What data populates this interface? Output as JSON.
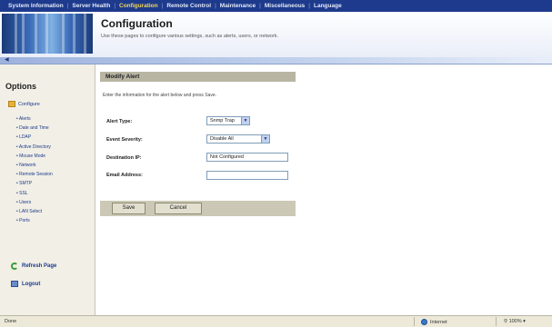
{
  "topnav": {
    "items": [
      {
        "label": "System Information",
        "active": false
      },
      {
        "label": "Server Health",
        "active": false
      },
      {
        "label": "Configuration",
        "active": true
      },
      {
        "label": "Remote Control",
        "active": false
      },
      {
        "label": "Maintenance",
        "active": false
      },
      {
        "label": "Miscellaneous",
        "active": false
      },
      {
        "label": "Language",
        "active": false
      }
    ]
  },
  "header": {
    "title": "Configuration",
    "subtitle": "Use these pages to configure various settings, such as alerts, users, or network."
  },
  "sidebar": {
    "title": "Options",
    "section": "Configure",
    "items": [
      "Alerts",
      "Date and Time",
      "LDAP",
      "Active Directory",
      "Mouse Mode",
      "Network",
      "Remote Session",
      "SMTP",
      "SSL",
      "Users",
      "LAN Select",
      "Ports"
    ],
    "refresh": "Refresh Page",
    "logout": "Logout"
  },
  "form": {
    "title": "Modify Alert",
    "instructions": "Enter the information for the alert below and press Save.",
    "alert_type_label": "Alert Type:",
    "alert_type_value": "Snmp Trap",
    "severity_label": "Event Severity:",
    "severity_value": "Disable All",
    "dest_label": "Destination IP:",
    "dest_value": "Not Configured",
    "email_label": "Email Address:",
    "email_value": "",
    "save": "Save",
    "cancel": "Cancel"
  },
  "status": {
    "left": "Done",
    "zone": "Internet",
    "zoom": "100%"
  },
  "colors": {
    "nav_bg": "#1d3a8c",
    "nav_active": "#f4d75a",
    "sidebar_bg": "#f1efe6",
    "panel_title_bg": "#b8b5a2"
  }
}
